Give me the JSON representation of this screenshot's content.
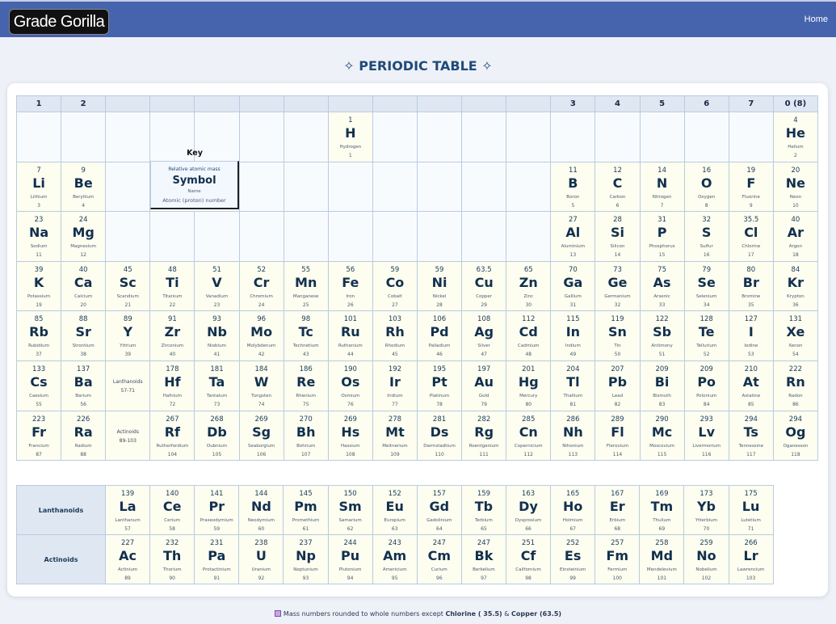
{
  "header": {
    "logo": "Grade Gorilla",
    "home_label": "Home"
  },
  "page_title": "✧ PERIODIC TABLE ✧",
  "group_headers": [
    "1",
    "2",
    "",
    "",
    "",
    "",
    "",
    "",
    "",
    "",
    "",
    "",
    "3",
    "4",
    "5",
    "6",
    "7",
    "0 (8)"
  ],
  "key": {
    "label": "Key",
    "mass_label": "Relative atomic mass",
    "symbol_label": "Symbol",
    "name_label": "Name",
    "number_label": "Atomic (proton) number"
  },
  "placeholders": [
    {
      "row": 6,
      "col": 3,
      "label": "Lanthanoids",
      "range": "57-71"
    },
    {
      "row": 7,
      "col": 3,
      "label": "Actinoids",
      "range": "89-103"
    }
  ],
  "elements": [
    {
      "sym": "H",
      "name": "Hydrogen",
      "num": 1,
      "mass": "1",
      "row": 1,
      "col": 8
    },
    {
      "sym": "He",
      "name": "Helium",
      "num": 2,
      "mass": "4",
      "row": 1,
      "col": 18
    },
    {
      "sym": "Li",
      "name": "Lithium",
      "num": 3,
      "mass": "7",
      "row": 2,
      "col": 1
    },
    {
      "sym": "Be",
      "name": "Beryllium",
      "num": 4,
      "mass": "9",
      "row": 2,
      "col": 2
    },
    {
      "sym": "B",
      "name": "Boron",
      "num": 5,
      "mass": "11",
      "row": 2,
      "col": 13
    },
    {
      "sym": "C",
      "name": "Carbon",
      "num": 6,
      "mass": "12",
      "row": 2,
      "col": 14
    },
    {
      "sym": "N",
      "name": "Nitrogen",
      "num": 7,
      "mass": "14",
      "row": 2,
      "col": 15
    },
    {
      "sym": "O",
      "name": "Oxygen",
      "num": 8,
      "mass": "16",
      "row": 2,
      "col": 16
    },
    {
      "sym": "F",
      "name": "Fluorine",
      "num": 9,
      "mass": "19",
      "row": 2,
      "col": 17
    },
    {
      "sym": "Ne",
      "name": "Neon",
      "num": 10,
      "mass": "20",
      "row": 2,
      "col": 18
    },
    {
      "sym": "Na",
      "name": "Sodium",
      "num": 11,
      "mass": "23",
      "row": 3,
      "col": 1
    },
    {
      "sym": "Mg",
      "name": "Magnesium",
      "num": 12,
      "mass": "24",
      "row": 3,
      "col": 2
    },
    {
      "sym": "Al",
      "name": "Aluminium",
      "num": 13,
      "mass": "27",
      "row": 3,
      "col": 13
    },
    {
      "sym": "Si",
      "name": "Silicon",
      "num": 14,
      "mass": "28",
      "row": 3,
      "col": 14
    },
    {
      "sym": "P",
      "name": "Phosphorus",
      "num": 15,
      "mass": "31",
      "row": 3,
      "col": 15
    },
    {
      "sym": "S",
      "name": "Sulfur",
      "num": 16,
      "mass": "32",
      "row": 3,
      "col": 16
    },
    {
      "sym": "Cl",
      "name": "Chlorine",
      "num": 17,
      "mass": "35.5",
      "row": 3,
      "col": 17
    },
    {
      "sym": "Ar",
      "name": "Argon",
      "num": 18,
      "mass": "40",
      "row": 3,
      "col": 18
    },
    {
      "sym": "K",
      "name": "Potassium",
      "num": 19,
      "mass": "39",
      "row": 4,
      "col": 1
    },
    {
      "sym": "Ca",
      "name": "Calcium",
      "num": 20,
      "mass": "40",
      "row": 4,
      "col": 2
    },
    {
      "sym": "Sc",
      "name": "Scandium",
      "num": 21,
      "mass": "45",
      "row": 4,
      "col": 3
    },
    {
      "sym": "Ti",
      "name": "Titanium",
      "num": 22,
      "mass": "48",
      "row": 4,
      "col": 4
    },
    {
      "sym": "V",
      "name": "Vanadium",
      "num": 23,
      "mass": "51",
      "row": 4,
      "col": 5
    },
    {
      "sym": "Cr",
      "name": "Chromium",
      "num": 24,
      "mass": "52",
      "row": 4,
      "col": 6
    },
    {
      "sym": "Mn",
      "name": "Manganese",
      "num": 25,
      "mass": "55",
      "row": 4,
      "col": 7
    },
    {
      "sym": "Fe",
      "name": "Iron",
      "num": 26,
      "mass": "56",
      "row": 4,
      "col": 8
    },
    {
      "sym": "Co",
      "name": "Cobalt",
      "num": 27,
      "mass": "59",
      "row": 4,
      "col": 9
    },
    {
      "sym": "Ni",
      "name": "Nickel",
      "num": 28,
      "mass": "59",
      "row": 4,
      "col": 10
    },
    {
      "sym": "Cu",
      "name": "Copper",
      "num": 29,
      "mass": "63.5",
      "row": 4,
      "col": 11
    },
    {
      "sym": "Zn",
      "name": "Zinc",
      "num": 30,
      "mass": "65",
      "row": 4,
      "col": 12
    },
    {
      "sym": "Ga",
      "name": "Gallium",
      "num": 31,
      "mass": "70",
      "row": 4,
      "col": 13
    },
    {
      "sym": "Ge",
      "name": "Germanium",
      "num": 32,
      "mass": "73",
      "row": 4,
      "col": 14
    },
    {
      "sym": "As",
      "name": "Arsenic",
      "num": 33,
      "mass": "75",
      "row": 4,
      "col": 15
    },
    {
      "sym": "Se",
      "name": "Selenium",
      "num": 34,
      "mass": "79",
      "row": 4,
      "col": 16
    },
    {
      "sym": "Br",
      "name": "Bromine",
      "num": 35,
      "mass": "80",
      "row": 4,
      "col": 17
    },
    {
      "sym": "Kr",
      "name": "Krypton",
      "num": 36,
      "mass": "84",
      "row": 4,
      "col": 18
    },
    {
      "sym": "Rb",
      "name": "Rubidium",
      "num": 37,
      "mass": "85",
      "row": 5,
      "col": 1
    },
    {
      "sym": "Sr",
      "name": "Strontium",
      "num": 38,
      "mass": "88",
      "row": 5,
      "col": 2
    },
    {
      "sym": "Y",
      "name": "Yttrium",
      "num": 39,
      "mass": "89",
      "row": 5,
      "col": 3
    },
    {
      "sym": "Zr",
      "name": "Zirconium",
      "num": 40,
      "mass": "91",
      "row": 5,
      "col": 4
    },
    {
      "sym": "Nb",
      "name": "Niobium",
      "num": 41,
      "mass": "93",
      "row": 5,
      "col": 5
    },
    {
      "sym": "Mo",
      "name": "Molybdenum",
      "num": 42,
      "mass": "96",
      "row": 5,
      "col": 6
    },
    {
      "sym": "Tc",
      "name": "Technetium",
      "num": 43,
      "mass": "98",
      "row": 5,
      "col": 7
    },
    {
      "sym": "Ru",
      "name": "Ruthenium",
      "num": 44,
      "mass": "101",
      "row": 5,
      "col": 8
    },
    {
      "sym": "Rh",
      "name": "Rhodium",
      "num": 45,
      "mass": "103",
      "row": 5,
      "col": 9
    },
    {
      "sym": "Pd",
      "name": "Palladium",
      "num": 46,
      "mass": "106",
      "row": 5,
      "col": 10
    },
    {
      "sym": "Ag",
      "name": "Silver",
      "num": 47,
      "mass": "108",
      "row": 5,
      "col": 11
    },
    {
      "sym": "Cd",
      "name": "Cadmium",
      "num": 48,
      "mass": "112",
      "row": 5,
      "col": 12
    },
    {
      "sym": "In",
      "name": "Indium",
      "num": 49,
      "mass": "115",
      "row": 5,
      "col": 13
    },
    {
      "sym": "Sn",
      "name": "Tin",
      "num": 50,
      "mass": "119",
      "row": 5,
      "col": 14
    },
    {
      "sym": "Sb",
      "name": "Antimony",
      "num": 51,
      "mass": "122",
      "row": 5,
      "col": 15
    },
    {
      "sym": "Te",
      "name": "Tellurium",
      "num": 52,
      "mass": "128",
      "row": 5,
      "col": 16
    },
    {
      "sym": "I",
      "name": "Iodine",
      "num": 53,
      "mass": "127",
      "row": 5,
      "col": 17
    },
    {
      "sym": "Xe",
      "name": "Xenon",
      "num": 54,
      "mass": "131",
      "row": 5,
      "col": 18
    },
    {
      "sym": "Cs",
      "name": "Caesium",
      "num": 55,
      "mass": "133",
      "row": 6,
      "col": 1
    },
    {
      "sym": "Ba",
      "name": "Barium",
      "num": 56,
      "mass": "137",
      "row": 6,
      "col": 2
    },
    {
      "sym": "Hf",
      "name": "Hafnium",
      "num": 72,
      "mass": "178",
      "row": 6,
      "col": 4
    },
    {
      "sym": "Ta",
      "name": "Tantalum",
      "num": 73,
      "mass": "181",
      "row": 6,
      "col": 5
    },
    {
      "sym": "W",
      "name": "Tungsten",
      "num": 74,
      "mass": "184",
      "row": 6,
      "col": 6
    },
    {
      "sym": "Re",
      "name": "Rhenium",
      "num": 75,
      "mass": "186",
      "row": 6,
      "col": 7
    },
    {
      "sym": "Os",
      "name": "Osmium",
      "num": 76,
      "mass": "190",
      "row": 6,
      "col": 8
    },
    {
      "sym": "Ir",
      "name": "Iridium",
      "num": 77,
      "mass": "192",
      "row": 6,
      "col": 9
    },
    {
      "sym": "Pt",
      "name": "Platinum",
      "num": 78,
      "mass": "195",
      "row": 6,
      "col": 10
    },
    {
      "sym": "Au",
      "name": "Gold",
      "num": 79,
      "mass": "197",
      "row": 6,
      "col": 11
    },
    {
      "sym": "Hg",
      "name": "Mercury",
      "num": 80,
      "mass": "201",
      "row": 6,
      "col": 12
    },
    {
      "sym": "Tl",
      "name": "Thallium",
      "num": 81,
      "mass": "204",
      "row": 6,
      "col": 13
    },
    {
      "sym": "Pb",
      "name": "Lead",
      "num": 82,
      "mass": "207",
      "row": 6,
      "col": 14
    },
    {
      "sym": "Bi",
      "name": "Bismuth",
      "num": 83,
      "mass": "209",
      "row": 6,
      "col": 15
    },
    {
      "sym": "Po",
      "name": "Polonium",
      "num": 84,
      "mass": "209",
      "row": 6,
      "col": 16
    },
    {
      "sym": "At",
      "name": "Astatine",
      "num": 85,
      "mass": "210",
      "row": 6,
      "col": 17
    },
    {
      "sym": "Rn",
      "name": "Radon",
      "num": 86,
      "mass": "222",
      "row": 6,
      "col": 18
    },
    {
      "sym": "Fr",
      "name": "Francium",
      "num": 87,
      "mass": "223",
      "row": 7,
      "col": 1
    },
    {
      "sym": "Ra",
      "name": "Radium",
      "num": 88,
      "mass": "226",
      "row": 7,
      "col": 2
    },
    {
      "sym": "Rf",
      "name": "Rutherfordium",
      "num": 104,
      "mass": "267",
      "row": 7,
      "col": 4
    },
    {
      "sym": "Db",
      "name": "Dubnium",
      "num": 105,
      "mass": "268",
      "row": 7,
      "col": 5
    },
    {
      "sym": "Sg",
      "name": "Seaborgium",
      "num": 106,
      "mass": "269",
      "row": 7,
      "col": 6
    },
    {
      "sym": "Bh",
      "name": "Bohrium",
      "num": 107,
      "mass": "270",
      "row": 7,
      "col": 7
    },
    {
      "sym": "Hs",
      "name": "Hassium",
      "num": 108,
      "mass": "269",
      "row": 7,
      "col": 8
    },
    {
      "sym": "Mt",
      "name": "Meitnerium",
      "num": 109,
      "mass": "278",
      "row": 7,
      "col": 9
    },
    {
      "sym": "Ds",
      "name": "Darmstadtium",
      "num": 110,
      "mass": "281",
      "row": 7,
      "col": 10
    },
    {
      "sym": "Rg",
      "name": "Roentgenium",
      "num": 111,
      "mass": "282",
      "row": 7,
      "col": 11
    },
    {
      "sym": "Cn",
      "name": "Copernicium",
      "num": 112,
      "mass": "285",
      "row": 7,
      "col": 12
    },
    {
      "sym": "Nh",
      "name": "Nihonium",
      "num": 113,
      "mass": "286",
      "row": 7,
      "col": 13
    },
    {
      "sym": "Fl",
      "name": "Flerovium",
      "num": 114,
      "mass": "289",
      "row": 7,
      "col": 14
    },
    {
      "sym": "Mc",
      "name": "Moscovium",
      "num": 115,
      "mass": "290",
      "row": 7,
      "col": 15
    },
    {
      "sym": "Lv",
      "name": "Livermorium",
      "num": 116,
      "mass": "293",
      "row": 7,
      "col": 16
    },
    {
      "sym": "Ts",
      "name": "Tennessine",
      "num": 117,
      "mass": "294",
      "row": 7,
      "col": 17
    },
    {
      "sym": "Og",
      "name": "Oganesson",
      "num": 118,
      "mass": "294",
      "row": 7,
      "col": 18
    }
  ],
  "f_block": [
    {
      "label": "Lanthanoids",
      "elements": [
        {
          "sym": "La",
          "name": "Lanthanum",
          "num": 57,
          "mass": "139"
        },
        {
          "sym": "Ce",
          "name": "Cerium",
          "num": 58,
          "mass": "140"
        },
        {
          "sym": "Pr",
          "name": "Praseodymium",
          "num": 59,
          "mass": "141"
        },
        {
          "sym": "Nd",
          "name": "Neodymium",
          "num": 60,
          "mass": "144"
        },
        {
          "sym": "Pm",
          "name": "Promethium",
          "num": 61,
          "mass": "145"
        },
        {
          "sym": "Sm",
          "name": "Samarium",
          "num": 62,
          "mass": "150"
        },
        {
          "sym": "Eu",
          "name": "Europium",
          "num": 63,
          "mass": "152"
        },
        {
          "sym": "Gd",
          "name": "Gadolinium",
          "num": 64,
          "mass": "157"
        },
        {
          "sym": "Tb",
          "name": "Terbium",
          "num": 65,
          "mass": "159"
        },
        {
          "sym": "Dy",
          "name": "Dysprosium",
          "num": 66,
          "mass": "163"
        },
        {
          "sym": "Ho",
          "name": "Holmium",
          "num": 67,
          "mass": "165"
        },
        {
          "sym": "Er",
          "name": "Erbium",
          "num": 68,
          "mass": "167"
        },
        {
          "sym": "Tm",
          "name": "Thulium",
          "num": 69,
          "mass": "169"
        },
        {
          "sym": "Yb",
          "name": "Ytterbium",
          "num": 70,
          "mass": "173"
        },
        {
          "sym": "Lu",
          "name": "Lutetium",
          "num": 71,
          "mass": "175"
        }
      ]
    },
    {
      "label": "Actinoids",
      "elements": [
        {
          "sym": "Ac",
          "name": "Actinium",
          "num": 89,
          "mass": "227"
        },
        {
          "sym": "Th",
          "name": "Thorium",
          "num": 90,
          "mass": "232"
        },
        {
          "sym": "Pa",
          "name": "Protactinium",
          "num": 91,
          "mass": "231"
        },
        {
          "sym": "U",
          "name": "Uranium",
          "num": 92,
          "mass": "238"
        },
        {
          "sym": "Np",
          "name": "Neptunium",
          "num": 93,
          "mass": "237"
        },
        {
          "sym": "Pu",
          "name": "Plutonium",
          "num": 94,
          "mass": "244"
        },
        {
          "sym": "Am",
          "name": "Americium",
          "num": 95,
          "mass": "243"
        },
        {
          "sym": "Cm",
          "name": "Curium",
          "num": 96,
          "mass": "247"
        },
        {
          "sym": "Bk",
          "name": "Berkelium",
          "num": 97,
          "mass": "247"
        },
        {
          "sym": "Cf",
          "name": "Californium",
          "num": 98,
          "mass": "251"
        },
        {
          "sym": "Es",
          "name": "Einsteinium",
          "num": 99,
          "mass": "252"
        },
        {
          "sym": "Fm",
          "name": "Fermium",
          "num": 100,
          "mass": "257"
        },
        {
          "sym": "Md",
          "name": "Mendelevium",
          "num": 101,
          "mass": "258"
        },
        {
          "sym": "No",
          "name": "Nobelium",
          "num": 102,
          "mass": "259"
        },
        {
          "sym": "Lr",
          "name": "Lawrencium",
          "num": 103,
          "mass": "266"
        }
      ]
    }
  ],
  "footnote": {
    "icon": "purple-square-icon",
    "text": "Mass numbers rounded to whole numbers except",
    "item1": "Chlorine ( 35.5)",
    "joiner": "&",
    "item2": "Copper (63.5)"
  },
  "colors": {
    "header_bar": "#4663ae",
    "cell_fill": "#fdfdf0",
    "group_header_fill": "#dfe7f2",
    "border": "#b9cce0",
    "title": "#1f4a7a"
  }
}
